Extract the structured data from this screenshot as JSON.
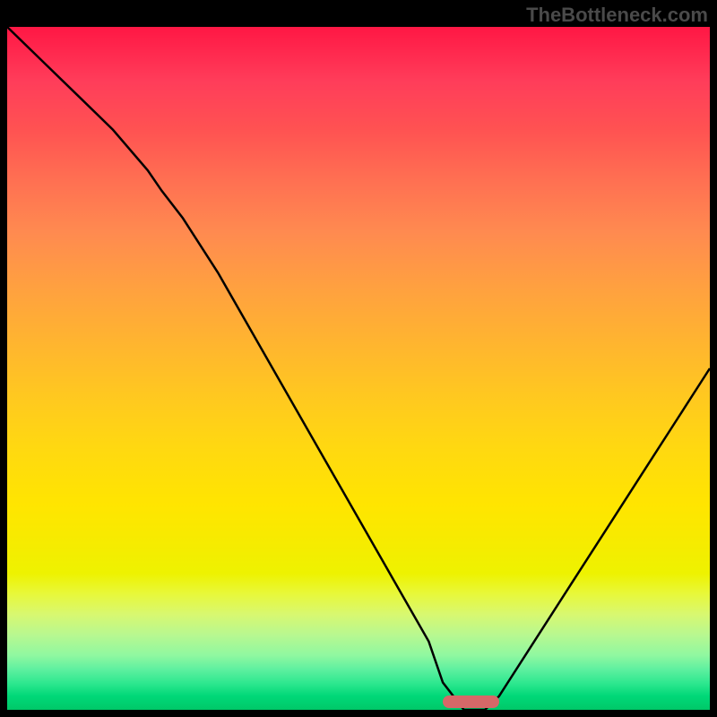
{
  "watermark": "TheBottleneck.com",
  "chart_data": {
    "type": "line",
    "title": "",
    "xlabel": "",
    "ylabel": "",
    "x": [
      0,
      5,
      10,
      15,
      20,
      22,
      25,
      30,
      35,
      40,
      45,
      50,
      55,
      60,
      62,
      65,
      68,
      70,
      75,
      80,
      85,
      90,
      95,
      100
    ],
    "values": [
      100,
      95,
      90,
      85,
      79,
      76,
      72,
      64,
      55,
      46,
      37,
      28,
      19,
      10,
      4,
      0,
      0,
      2,
      10,
      18,
      26,
      34,
      42,
      50
    ],
    "xlim": [
      0,
      100
    ],
    "ylim": [
      0,
      100
    ],
    "marker_region": {
      "x_start": 62,
      "x_end": 70,
      "y": 0
    },
    "gradient_colors": {
      "top": "#ff1744",
      "middle": "#ffd910",
      "bottom": "#00c868"
    }
  }
}
